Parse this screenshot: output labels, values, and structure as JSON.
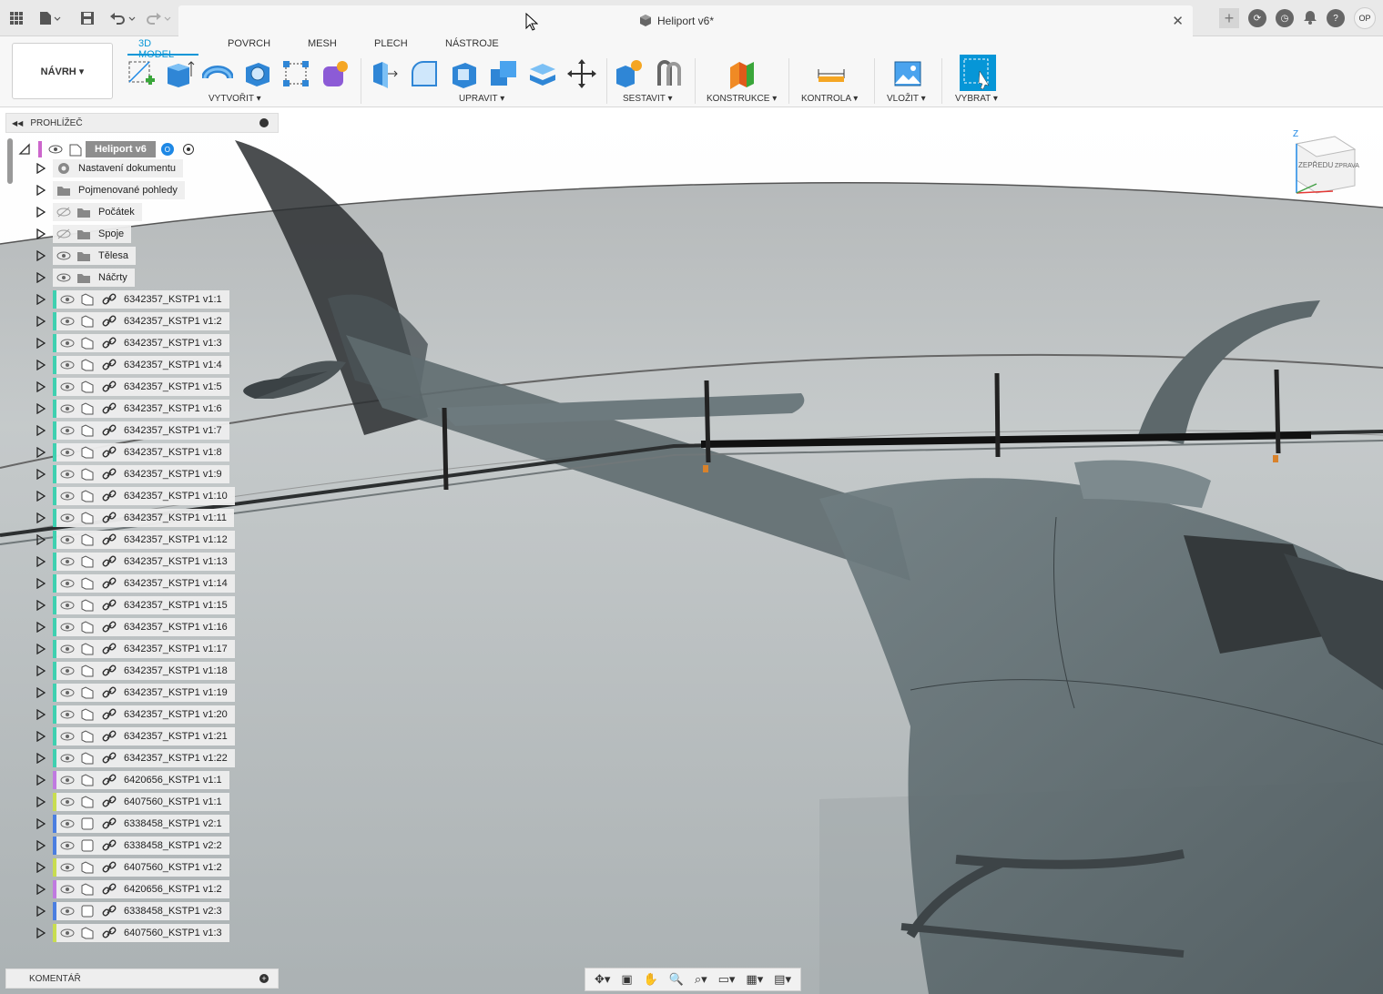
{
  "app": {
    "document_title": "Heliport v6*",
    "user_initials": "OP"
  },
  "ribbon": {
    "workspace_label": "NÁVRH ▾",
    "tabs": [
      "3D MODEL",
      "POVRCH",
      "MESH",
      "PLECH",
      "NÁSTROJE"
    ],
    "groups": {
      "create": "VYTVOŘIT ▾",
      "modify": "UPRAVIT ▾",
      "assemble": "SESTAVIT ▾",
      "construct": "KONSTRUKCE ▾",
      "inspect": "KONTROLA ▾",
      "insert": "VLOŽIT ▾",
      "select": "VYBRAT ▾"
    },
    "accent_color": "#0696d7"
  },
  "browser": {
    "title": "PROHLÍŽEČ",
    "root_label": "Heliport v6",
    "folders": [
      "Nastavení dokumentu",
      "Pojmenované pohledy",
      "Počátek",
      "Spoje",
      "Tělesa",
      "Náčrty"
    ],
    "components": [
      "6342357_KSTP1 v1:1",
      "6342357_KSTP1 v1:2",
      "6342357_KSTP1 v1:3",
      "6342357_KSTP1 v1:4",
      "6342357_KSTP1 v1:5",
      "6342357_KSTP1 v1:6",
      "6342357_KSTP1 v1:7",
      "6342357_KSTP1 v1:8",
      "6342357_KSTP1 v1:9",
      "6342357_KSTP1 v1:10",
      "6342357_KSTP1 v1:11",
      "6342357_KSTP1 v1:12",
      "6342357_KSTP1 v1:13",
      "6342357_KSTP1 v1:14",
      "6342357_KSTP1 v1:15",
      "6342357_KSTP1 v1:16",
      "6342357_KSTP1 v1:17",
      "6342357_KSTP1 v1:18",
      "6342357_KSTP1 v1:19",
      "6342357_KSTP1 v1:20",
      "6342357_KSTP1 v1:21",
      "6342357_KSTP1 v1:22",
      "6420656_KSTP1 v1:1",
      "6407560_KSTP1 v1:1",
      "6338458_KSTP1 v2:1",
      "6338458_KSTP1 v2:2",
      "6407560_KSTP1 v1:2",
      "6420656_KSTP1 v1:2",
      "6338458_KSTP1 v2:3",
      "6407560_KSTP1 v1:3"
    ]
  },
  "comments": {
    "label": "KOMENTÁŘ"
  },
  "viewcube": {
    "front": "ZEPŘEDU",
    "right": "ZPRAVA",
    "axis_z": "Z"
  }
}
